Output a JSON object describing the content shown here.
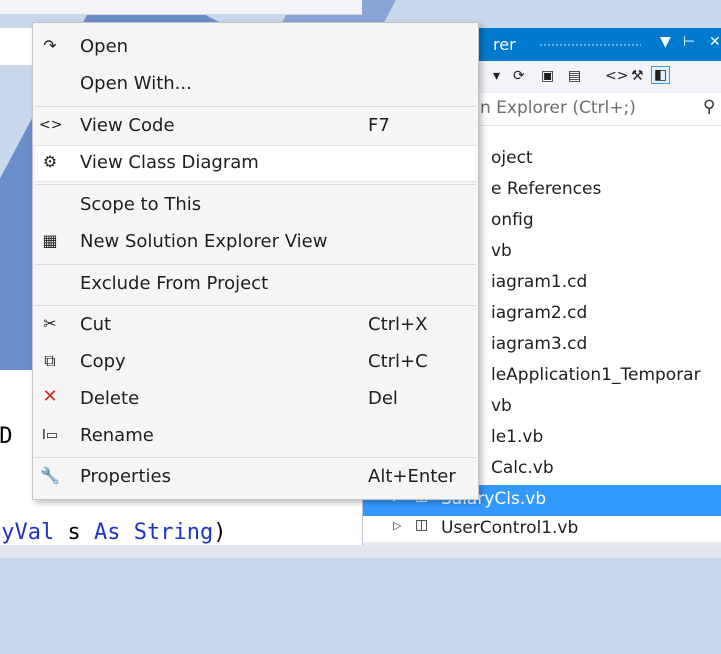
{
  "context_menu": {
    "items": [
      {
        "label": "Open",
        "shortcut": "",
        "icon": "open-arrow-icon"
      },
      {
        "label": "Open With...",
        "shortcut": "",
        "icon": ""
      },
      {
        "label": "View Code",
        "shortcut": "F7",
        "icon": "code-brackets-icon"
      },
      {
        "label": "View Class Diagram",
        "shortcut": "",
        "icon": "class-diagram-icon"
      },
      {
        "label": "Scope to This",
        "shortcut": "",
        "icon": ""
      },
      {
        "label": "New Solution Explorer View",
        "shortcut": "",
        "icon": "new-window-icon"
      },
      {
        "label": "Exclude From Project",
        "shortcut": "",
        "icon": ""
      },
      {
        "label": "Cut",
        "shortcut": "Ctrl+X",
        "icon": "scissors-icon"
      },
      {
        "label": "Copy",
        "shortcut": "Ctrl+C",
        "icon": "copy-icon"
      },
      {
        "label": "Delete",
        "shortcut": "Del",
        "icon": "delete-x-icon"
      },
      {
        "label": "Rename",
        "shortcut": "",
        "icon": "rename-icon"
      },
      {
        "label": "Properties",
        "shortcut": "Alt+Enter",
        "icon": "wrench-icon"
      }
    ],
    "hovered_item": "View Class Diagram"
  },
  "solution_explorer": {
    "title_fragment": "rer",
    "search_placeholder": "n Explorer (Ctrl+;)",
    "rows": [
      {
        "label": "oject"
      },
      {
        "label": "e References"
      },
      {
        "label": "onfig"
      },
      {
        "label": "vb"
      },
      {
        "label": "iagram1.cd"
      },
      {
        "label": "iagram2.cd"
      },
      {
        "label": "iagram3.cd"
      },
      {
        "label": "leApplication1_Temporar"
      },
      {
        "label": "vb"
      },
      {
        "label": "le1.vb"
      },
      {
        "label": "Calc.vb"
      },
      {
        "label": "SalaryCls.vb"
      },
      {
        "label": "UserControl1.vb"
      }
    ],
    "selected": "SalaryCls.vb"
  },
  "editor": {
    "line1": "rD",
    "line2_kw1": "ByVal",
    "line2_mid": " s ",
    "line2_kw2": "As",
    "line2_sp": " ",
    "line2_type": "String",
    "line2_end": ")"
  },
  "colors": {
    "accent": "#007acc",
    "selection": "#3399ff",
    "delete_red": "#c5281c",
    "keyword_blue": "#1f33c9"
  }
}
